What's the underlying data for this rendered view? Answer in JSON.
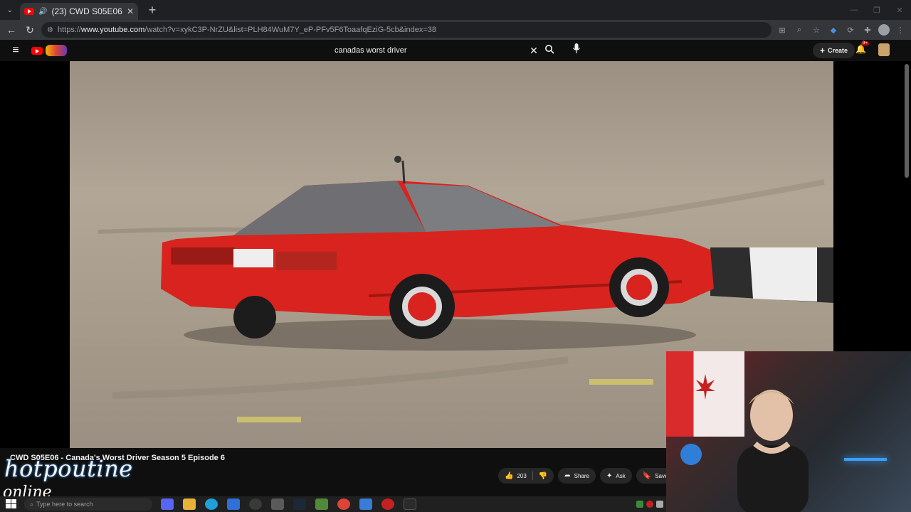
{
  "browser": {
    "tab_title": "(23) CWD S05E06 - Canada's",
    "url_prefix": "https://",
    "url_domain": "www.youtube.com",
    "url_rest": "/watch?v=xykC3P-NrZU&list=PLH84WuM7Y_eP-PFv5F6ToaafqEziG-5cb&index=38"
  },
  "youtube": {
    "search_query": "canadas worst driver",
    "create_label": "Create",
    "notification_badge": "9+",
    "video_title": "CWD S05E06 - Canada's Worst Driver Season 5 Episode 6",
    "likes": "203",
    "share_label": "Share",
    "ask_label": "Ask",
    "save_label": "Save"
  },
  "overlay": {
    "logo_text": "hotpoutine",
    "sub_text": "online"
  },
  "taskbar": {
    "search_placeholder": "Type here to search"
  },
  "colors": {
    "accent": "#ff0000",
    "car_red": "#d8231f",
    "background": "#0f0f0f"
  }
}
